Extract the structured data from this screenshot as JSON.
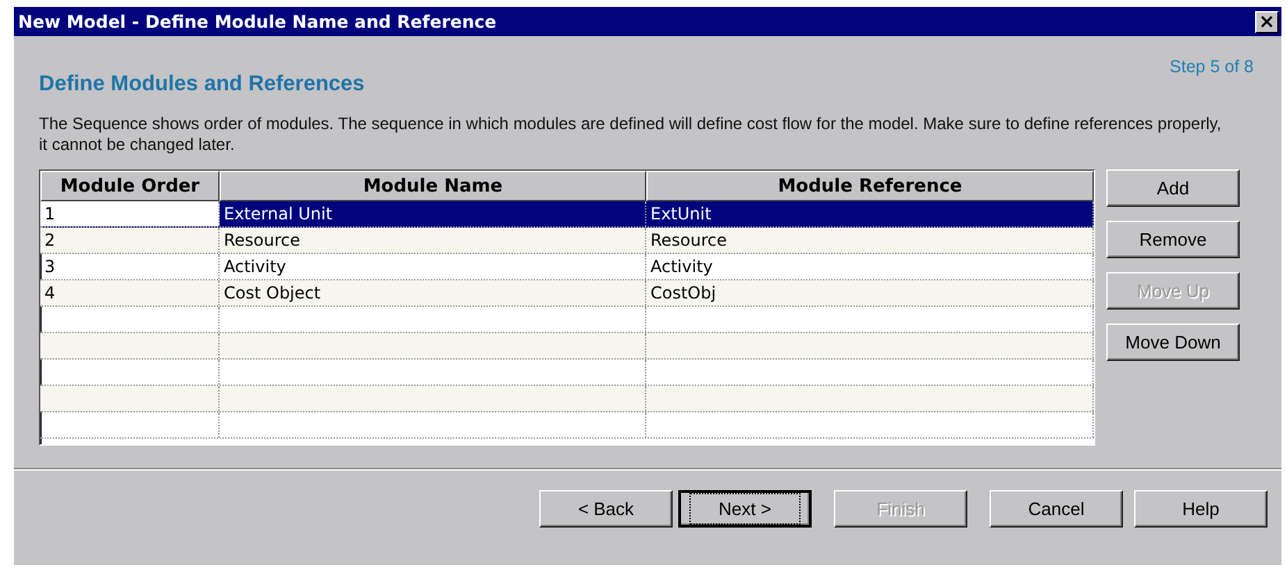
{
  "window": {
    "title": "New Model - Define Module Name and Reference",
    "close": "×"
  },
  "header": {
    "title": "Define Modules and References",
    "step": "Step 5 of 8"
  },
  "description": "The Sequence shows order of modules. The sequence in which modules are defined will define cost flow for the model. Make sure to define references properly, it cannot be changed later.",
  "table": {
    "columns": [
      "Module Order",
      "Module Name",
      "Module Reference"
    ],
    "rows": [
      {
        "cells": [
          "1",
          "External Unit",
          "ExtUnit"
        ],
        "selected": true
      },
      {
        "cells": [
          "2",
          "Resource",
          "Resource"
        ],
        "selected": false
      },
      {
        "cells": [
          "3",
          "Activity",
          "Activity"
        ],
        "selected": false
      },
      {
        "cells": [
          "4",
          "Cost Object",
          "CostObj"
        ],
        "selected": false
      }
    ]
  },
  "side_buttons": [
    {
      "label": "Add",
      "disabled": false
    },
    {
      "label": "Remove",
      "disabled": false
    },
    {
      "label": "Move Up",
      "disabled": true
    },
    {
      "label": "Move Down",
      "disabled": false
    }
  ],
  "footer_buttons": [
    {
      "label": "< Back",
      "disabled": false,
      "default": false
    },
    {
      "label": "Next >",
      "disabled": false,
      "default": true
    },
    {
      "label": "Finish",
      "disabled": true,
      "default": false
    },
    {
      "label": "Cancel",
      "disabled": false,
      "default": false
    },
    {
      "label": "Help",
      "disabled": false,
      "default": false
    }
  ]
}
